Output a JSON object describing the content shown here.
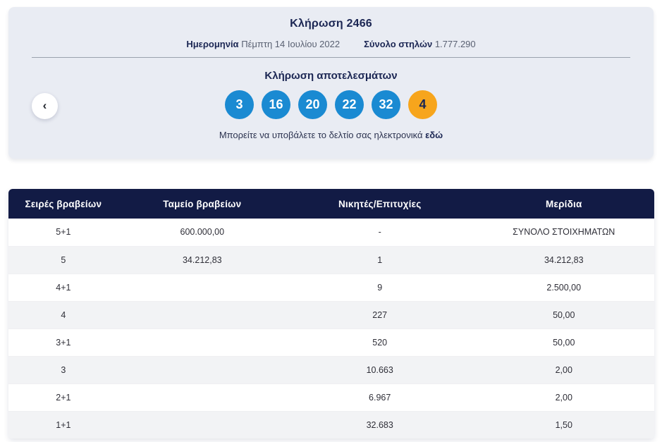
{
  "draw_panel": {
    "title": "Κλήρωση 2466",
    "date_label": "Ημερομηνία",
    "date_value": "Πέμπτη 14 Ιουλίου 2022",
    "columns_label": "Σύνολο στηλών",
    "columns_value": "1.777.290",
    "results_heading": "Κλήρωση αποτελεσμάτων",
    "numbers": [
      "3",
      "16",
      "20",
      "22",
      "32"
    ],
    "bonus_number": "4",
    "note_text": "Μπορείτε να υποβάλετε το δελτίο σας ηλεκτρονικά",
    "note_link_label": "εδώ",
    "prev_button_icon": "chevron-left"
  },
  "results_table": {
    "headers": [
      "Σειρές βραβείων",
      "Ταμείο βραβείων",
      "Νικητές/Επιτυχίες",
      "Μερίδια"
    ],
    "rows": [
      [
        "5+1",
        "600.000,00",
        "-",
        "ΣΥΝΟΛΟ ΣΤΟΙΧΗΜΑΤΩΝ"
      ],
      [
        "5",
        "34.212,83",
        "1",
        "34.212,83"
      ],
      [
        "4+1",
        "",
        "9",
        "2.500,00"
      ],
      [
        "4",
        "",
        "227",
        "50,00"
      ],
      [
        "3+1",
        "",
        "520",
        "50,00"
      ],
      [
        "3",
        "",
        "10.663",
        "2,00"
      ],
      [
        "2+1",
        "",
        "6.967",
        "2,00"
      ],
      [
        "1+1",
        "",
        "32.683",
        "1,50"
      ]
    ]
  },
  "colors": {
    "panel_bg": "#e9ecf3",
    "number_ball": "#1a8ad2",
    "bonus_ball": "#f7a51c",
    "table_header_bg": "#121b45",
    "row_alt_bg": "#f2f3f5",
    "navy_text": "#1b2653"
  }
}
